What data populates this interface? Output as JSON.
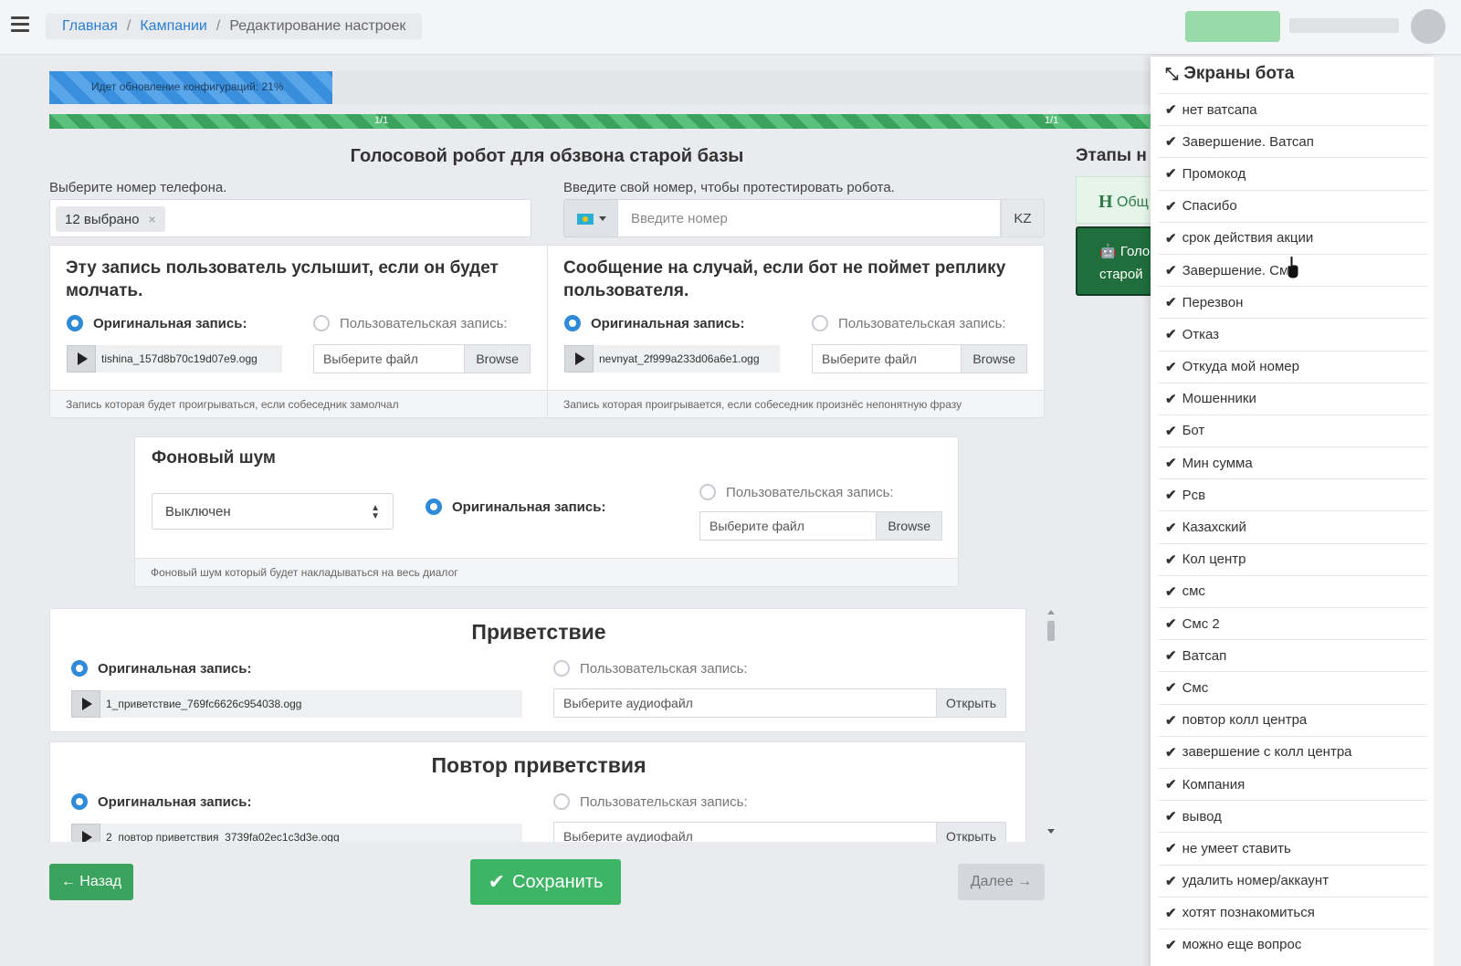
{
  "breadcrumb": {
    "home": "Главная",
    "campaigns": "Кампании",
    "current": "Редактирование настроек"
  },
  "progress": {
    "update_text": "Идет обновление конфигураций: 21%",
    "update_fraction": 0.21,
    "steps_left": "1/1",
    "steps_right": "1/1"
  },
  "page_title": "Голосовой робот для обзвона старой базы",
  "phone": {
    "label": "Выберите номер телефона.",
    "selected_tag": "12 выбрано",
    "remove": "×"
  },
  "test": {
    "label": "Введите свой номер, чтобы протестировать робота.",
    "placeholder": "Введите номер",
    "country": "KZ"
  },
  "silence": {
    "title": "Эту запись пользователь услышит, если он будет молчать.",
    "original_label": "Оригинальная запись:",
    "custom_label": "Пользовательская запись:",
    "file_name": "tishina_157d8b70c19d07e9.ogg",
    "file_placeholder": "Выберите файл",
    "browse": "Browse",
    "footer": "Запись которая будет проигрываться, если собеседник замолчал"
  },
  "fallback": {
    "title": "Сообщение на случай, если бот не поймет реплику пользователя.",
    "original_label": "Оригинальная запись:",
    "custom_label": "Пользовательская запись:",
    "file_name": "nevnyat_2f999a233d06a6e1.ogg",
    "file_placeholder": "Выберите файл",
    "browse": "Browse",
    "footer": "Запись которая проигрывается, если собеседник произнёс непонятную фразу"
  },
  "noise": {
    "title": "Фоновый шум",
    "select_value": "Выключен",
    "original_label": "Оригинальная запись:",
    "custom_label": "Пользовательская запись:",
    "file_placeholder": "Выберите файл",
    "browse": "Browse",
    "footer": "Фоновый шум который будет накладываться на весь диалог"
  },
  "greeting": {
    "title": "Приветствие",
    "original_label": "Оригинальная запись:",
    "custom_label": "Пользовательская запись:",
    "file_name": "1_приветствие_769fc6626c954038.ogg",
    "file_placeholder": "Выберите аудиофайл",
    "open": "Открыть"
  },
  "greeting_repeat": {
    "title": "Повтор приветствия",
    "original_label": "Оригинальная запись:",
    "custom_label": "Пользовательская запись:",
    "file_name": "2_повтор приветствия_3739fa02ec1c3d3e.ogg",
    "file_placeholder": "Выберите аудиофайл",
    "open": "Открыть"
  },
  "footer_buttons": {
    "back": "← Назад",
    "save": "Сохранить",
    "next": "Далее →"
  },
  "stages": {
    "title": "Этапы н",
    "item1_letter": "H",
    "item1_text": "Общ",
    "item2_line1": "Голо",
    "item2_line2": "старой"
  },
  "side_panel": {
    "title": "Экраны бота",
    "items": [
      "нет ватсапа",
      "Завершение. Ватсап",
      "Промокод",
      "Спасибо",
      "срок действия акции",
      "Завершение. Смс",
      "Перезвон",
      "Отказ",
      "Откуда мой номер",
      "Мошенники",
      "Бот",
      "Мин сумма",
      "Рсв",
      "Казахский",
      "Кол центр",
      "смс",
      "Смс 2",
      "Ватсап",
      "Смс",
      "повтор колл центра",
      "завершение с колл центра",
      "Компания",
      "вывод",
      "не умеет ставить",
      "удалить номер/аккаунт",
      "хотят познакомиться",
      "можно еще вопрос"
    ]
  },
  "colors": {
    "primary": "#2f8ad9",
    "success": "#3db565",
    "dark_green": "#1f6e3b"
  }
}
